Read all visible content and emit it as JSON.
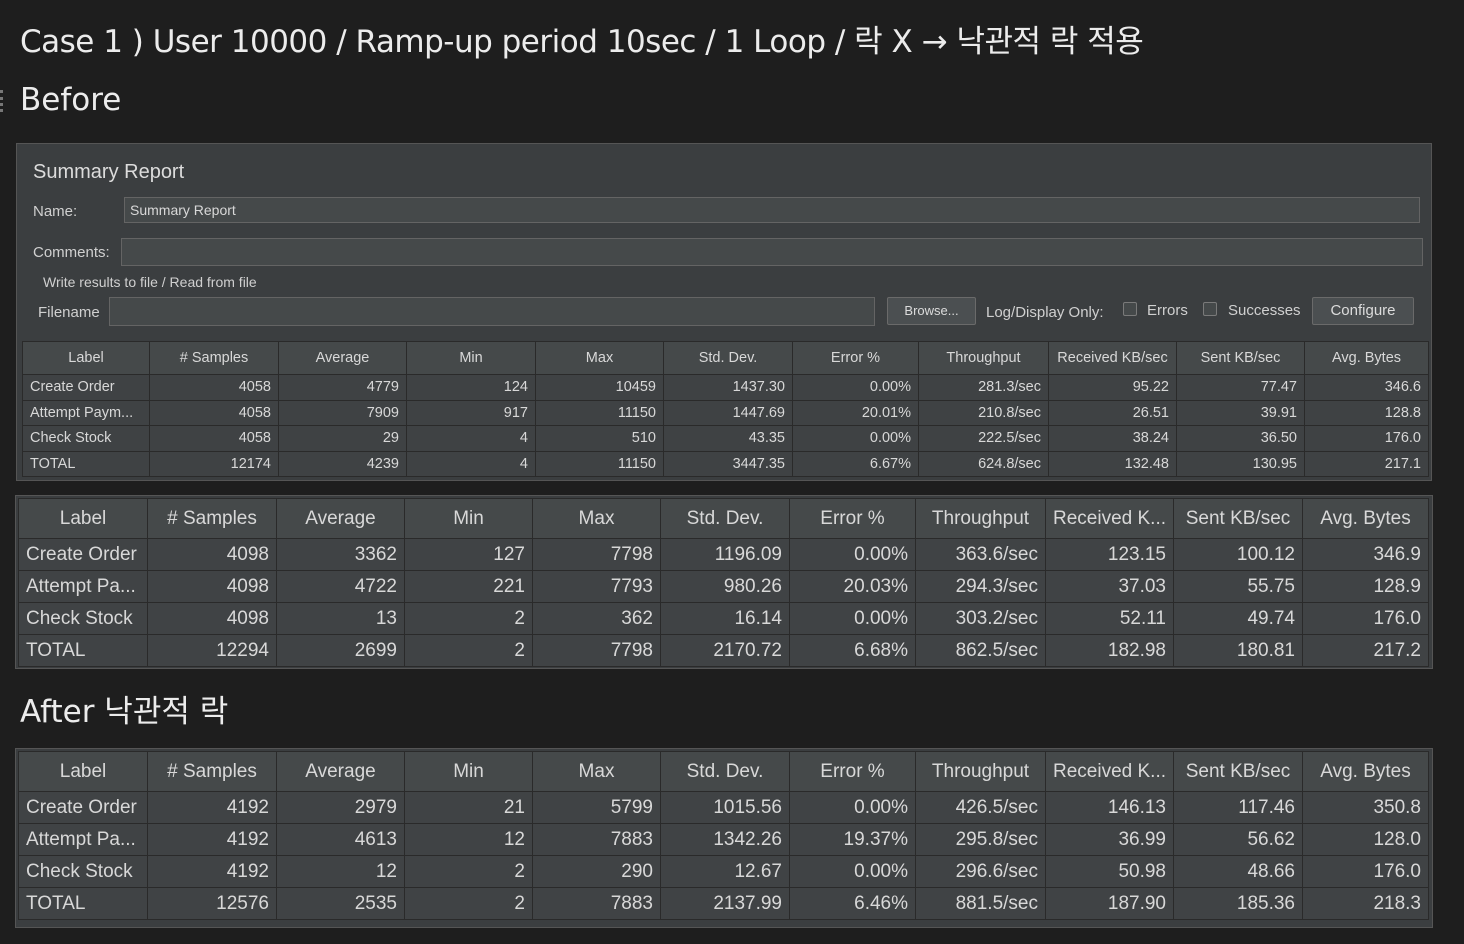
{
  "case_title": "Case 1 ) User 10000 / Ramp-up period 10sec / 1 Loop / 락 X → 낙관적 락 적용",
  "before_heading": "Before",
  "after_heading": "After 낙관적 락",
  "panel": {
    "title": "Summary Report",
    "name_label": "Name:",
    "name_value": "Summary Report",
    "comments_label": "Comments:",
    "comments_value": "",
    "group_title": "Write results to file / Read from file",
    "filename_label": "Filename",
    "filename_value": "",
    "browse_button": "Browse...",
    "log_display_label": "Log/Display Only:",
    "errors_label": "Errors",
    "successes_label": "Successes",
    "configure_button": "Configure"
  },
  "jmeter_table": {
    "headers": [
      "Label",
      "# Samples",
      "Average",
      "Min",
      "Max",
      "Std. Dev.",
      "Error %",
      "Throughput",
      "Received KB/sec",
      "Sent KB/sec",
      "Avg. Bytes"
    ],
    "rows": [
      [
        "Create Order",
        "4058",
        "4779",
        "124",
        "10459",
        "1437.30",
        "0.00%",
        "281.3/sec",
        "95.22",
        "77.47",
        "346.6"
      ],
      [
        "Attempt Paym...",
        "4058",
        "7909",
        "917",
        "11150",
        "1447.69",
        "20.01%",
        "210.8/sec",
        "26.51",
        "39.91",
        "128.8"
      ],
      [
        "Check Stock",
        "4058",
        "29",
        "4",
        "510",
        "43.35",
        "0.00%",
        "222.5/sec",
        "38.24",
        "36.50",
        "176.0"
      ],
      [
        "TOTAL",
        "12174",
        "4239",
        "4",
        "11150",
        "3447.35",
        "6.67%",
        "624.8/sec",
        "132.48",
        "130.95",
        "217.1"
      ]
    ]
  },
  "before_table": {
    "headers": [
      "Label",
      "# Samples",
      "Average",
      "Min",
      "Max",
      "Std. Dev.",
      "Error %",
      "Throughput",
      "Received K...",
      "Sent KB/sec",
      "Avg. Bytes"
    ],
    "rows": [
      [
        "Create Order",
        "4098",
        "3362",
        "127",
        "7798",
        "1196.09",
        "0.00%",
        "363.6/sec",
        "123.15",
        "100.12",
        "346.9"
      ],
      [
        "Attempt Pa...",
        "4098",
        "4722",
        "221",
        "7793",
        "980.26",
        "20.03%",
        "294.3/sec",
        "37.03",
        "55.75",
        "128.9"
      ],
      [
        "Check Stock",
        "4098",
        "13",
        "2",
        "362",
        "16.14",
        "0.00%",
        "303.2/sec",
        "52.11",
        "49.74",
        "176.0"
      ],
      [
        "TOTAL",
        "12294",
        "2699",
        "2",
        "7798",
        "2170.72",
        "6.68%",
        "862.5/sec",
        "182.98",
        "180.81",
        "217.2"
      ]
    ]
  },
  "after_table": {
    "headers": [
      "Label",
      "# Samples",
      "Average",
      "Min",
      "Max",
      "Std. Dev.",
      "Error %",
      "Throughput",
      "Received K...",
      "Sent KB/sec",
      "Avg. Bytes"
    ],
    "rows": [
      [
        "Create Order",
        "4192",
        "2979",
        "21",
        "5799",
        "1015.56",
        "0.00%",
        "426.5/sec",
        "146.13",
        "117.46",
        "350.8"
      ],
      [
        "Attempt Pa...",
        "4192",
        "4613",
        "12",
        "7883",
        "1342.26",
        "19.37%",
        "295.8/sec",
        "36.99",
        "56.62",
        "128.0"
      ],
      [
        "Check Stock",
        "4192",
        "12",
        "2",
        "290",
        "12.67",
        "0.00%",
        "296.6/sec",
        "50.98",
        "48.66",
        "176.0"
      ],
      [
        "TOTAL",
        "12576",
        "2535",
        "2",
        "7883",
        "2137.99",
        "6.46%",
        "881.5/sec",
        "187.90",
        "185.36",
        "218.3"
      ]
    ]
  }
}
